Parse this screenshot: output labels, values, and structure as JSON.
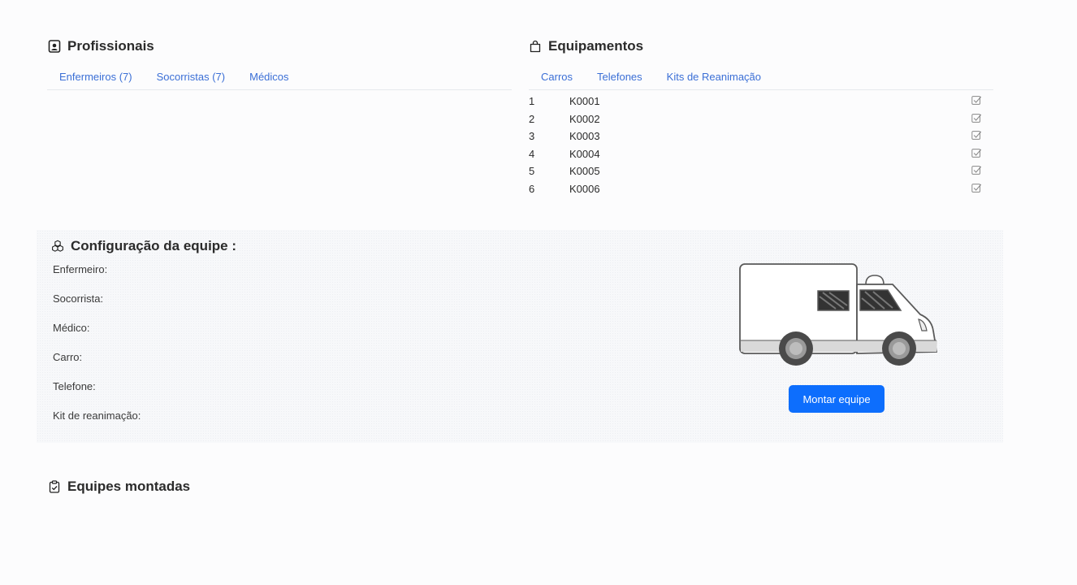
{
  "profissionais": {
    "title": "Profissionais",
    "tabs": [
      "Enfermeiros (7)",
      "Socorristas (7)",
      "Médicos"
    ]
  },
  "equipamentos": {
    "title": "Equipamentos",
    "tabs": [
      "Carros",
      "Telefones",
      "Kits de Reanimação"
    ],
    "kits": [
      {
        "index": "1",
        "code": "K0001"
      },
      {
        "index": "2",
        "code": "K0002"
      },
      {
        "index": "3",
        "code": "K0003"
      },
      {
        "index": "4",
        "code": "K0004"
      },
      {
        "index": "5",
        "code": "K0005"
      },
      {
        "index": "6",
        "code": "K0006"
      }
    ]
  },
  "config": {
    "title": "Configuração da equipe :",
    "fields": {
      "enfermeiro": "Enfermeiro:",
      "socorrista": "Socorrista:",
      "medico": "Médico:",
      "carro": "Carro:",
      "telefone": "Telefone:",
      "kit": "Kit de reanimação:"
    },
    "button_label": "Montar equipe",
    "accent_color": "#0d6efd"
  },
  "equipes": {
    "title": "Equipes montadas"
  },
  "icons": {
    "profissionais": "person-badge-icon",
    "equipamentos": "bag-icon",
    "config": "boxes-icon",
    "equipes": "clipboard-check-icon",
    "kit_row": "check-square-icon"
  }
}
